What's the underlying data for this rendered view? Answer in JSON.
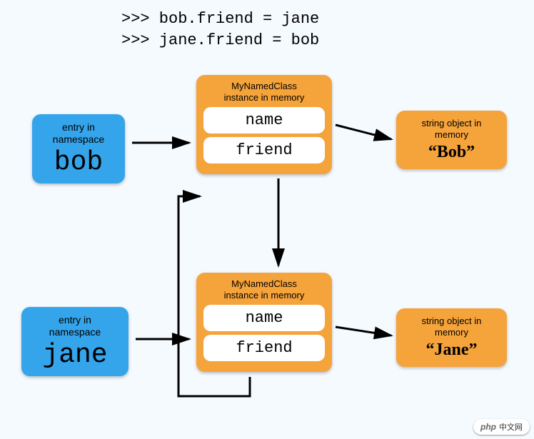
{
  "code": {
    "line1": ">>> bob.friend = jane",
    "line2": ">>> jane.friend = bob"
  },
  "namespace_bob": {
    "label_txt": "entry in\nnamespace",
    "var": "bob"
  },
  "namespace_jane": {
    "label_txt": "entry in\nnamespace",
    "var": "jane"
  },
  "bob_instance": {
    "header": "MyNamedClass\ninstance in memory",
    "attr1": "name",
    "attr2": "friend"
  },
  "jane_instance": {
    "header": "MyNamedClass\ninstance in memory",
    "attr1": "name",
    "attr2": "friend"
  },
  "bob_string": {
    "label_txt": "string object in\nmemory",
    "value": "“Bob”"
  },
  "jane_string": {
    "label_txt": "string object in\nmemory",
    "value": "“Jane”"
  },
  "watermark": {
    "logo": "php",
    "txt": "中文网"
  }
}
